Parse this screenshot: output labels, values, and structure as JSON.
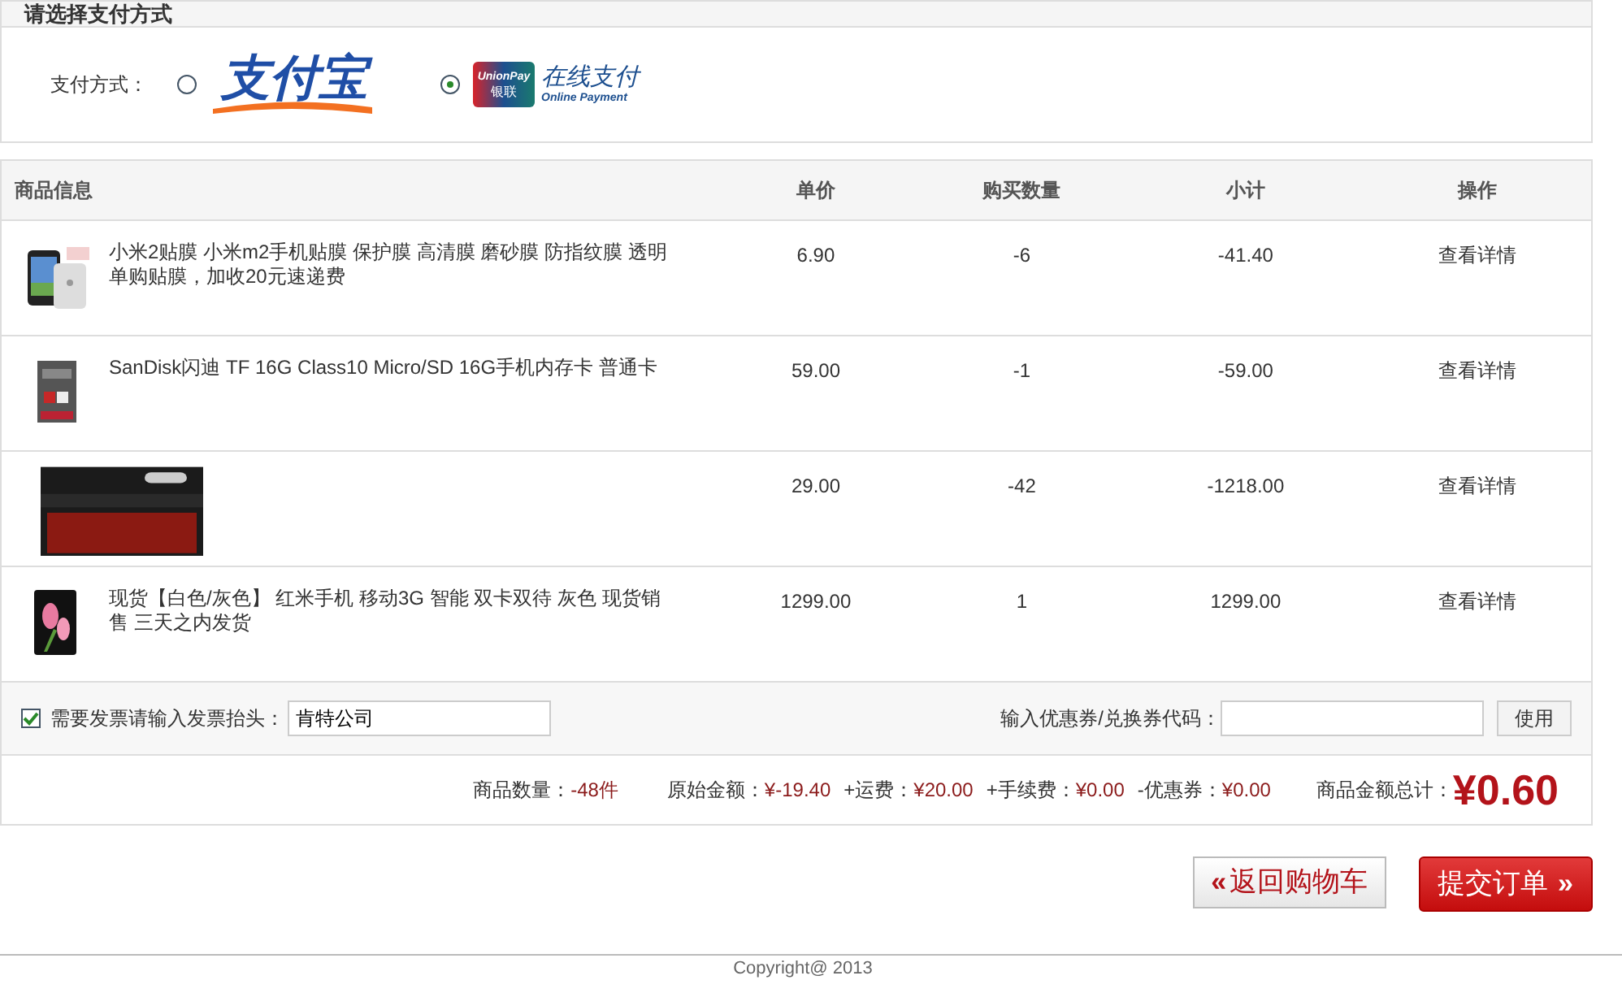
{
  "payment": {
    "title": "请选择支付方式",
    "label": "支付方式：",
    "options": [
      {
        "kind": "alipay",
        "selected": false,
        "logo_text": "支付宝"
      },
      {
        "kind": "unionpay",
        "selected": true,
        "logo_text": "UnionPay",
        "logo_sub": "银联",
        "caption": "在线支付",
        "caption_sub": "Online Payment"
      }
    ]
  },
  "table": {
    "columns": [
      "商品信息",
      "单价",
      "购买数量",
      "小计",
      "操作"
    ],
    "rows": [
      {
        "name": "小米2贴膜 小米m2手机贴膜 保护膜 高清膜 磨砂膜 防指纹膜 透明单购贴膜，加收20元速递费",
        "price": "6.90",
        "qty": "-6",
        "subtotal": "-41.40",
        "action": "查看详情"
      },
      {
        "name": "SanDisk闪迪 TF 16G Class10 Micro/SD 16G手机内存卡 普通卡",
        "price": "59.00",
        "qty": "-1",
        "subtotal": "-59.00",
        "action": "查看详情"
      },
      {
        "name": "",
        "price": "29.00",
        "qty": "-42",
        "subtotal": "-1218.00",
        "action": "查看详情"
      },
      {
        "name": "现货【白色/灰色】 红米手机 移动3G 智能 双卡双待 灰色 现货销售 三天之内发货",
        "price": "1299.00",
        "qty": "1",
        "subtotal": "1299.00",
        "action": "查看详情"
      }
    ]
  },
  "invoice": {
    "checked": true,
    "label": "需要发票请输入发票抬头：",
    "value": "肯特公司"
  },
  "coupon": {
    "label": "输入优惠券/兑换券代码：",
    "button": "使用"
  },
  "summary": {
    "items": [
      {
        "label": "商品数量：",
        "value": "-48件"
      },
      {
        "label": "原始金额：",
        "value": "¥-19.40"
      },
      {
        "label": "+运费：",
        "value": "¥20.00"
      },
      {
        "label": "+手续费：",
        "value": "¥0.00"
      },
      {
        "label": "-优惠券：",
        "value": "¥0.00"
      }
    ],
    "total_label": "商品金额总计：",
    "total": "¥0.60"
  },
  "buttons": {
    "back_arrow": "«",
    "back": "返回购物车",
    "submit": "提交订单",
    "submit_arrow": "»"
  },
  "footer": {
    "copyright": "Copyright@ 2013"
  }
}
